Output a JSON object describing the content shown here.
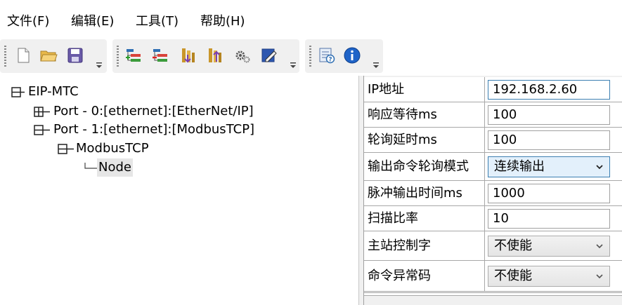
{
  "menu": [
    {
      "label": "文件(F)"
    },
    {
      "label": "编辑(E)"
    },
    {
      "label": "工具(T)"
    },
    {
      "label": "帮助(H)"
    }
  ],
  "toolbar": {
    "groups": [
      {
        "buttons": [
          "new-file-icon",
          "open-folder-icon",
          "save-icon"
        ]
      },
      {
        "buttons": [
          "add-node-icon",
          "remove-node-icon",
          "download-icon",
          "upload-icon",
          "settings-gears-icon",
          "edit-icon"
        ]
      },
      {
        "buttons": [
          "help-doc-icon",
          "info-icon"
        ]
      }
    ]
  },
  "tree": {
    "root": "EIP-MTC",
    "port0": "Port - 0:[ethernet]:[EtherNet/IP]",
    "port1": "Port - 1:[ethernet]:[ModbusTCP]",
    "modbus": "ModbusTCP",
    "node": "Node"
  },
  "props": [
    {
      "label": "IP地址",
      "value": "192.168.2.60"
    },
    {
      "label": "响应等待ms",
      "value": "100"
    },
    {
      "label": "轮询延时ms",
      "value": "100"
    },
    {
      "label": "输出命令轮询模式",
      "value": "连续输出"
    },
    {
      "label": "脉冲输出时间ms",
      "value": "1000"
    },
    {
      "label": "扫描比率",
      "value": "10"
    },
    {
      "label": "主站控制字",
      "value": "不使能"
    },
    {
      "label": "命令异常码",
      "value": "不使能"
    }
  ],
  "colors": {
    "accent": "#3c7fb1",
    "selected_bg": "#e6e6e6",
    "toolbar_bg": "#f0f0f0"
  }
}
